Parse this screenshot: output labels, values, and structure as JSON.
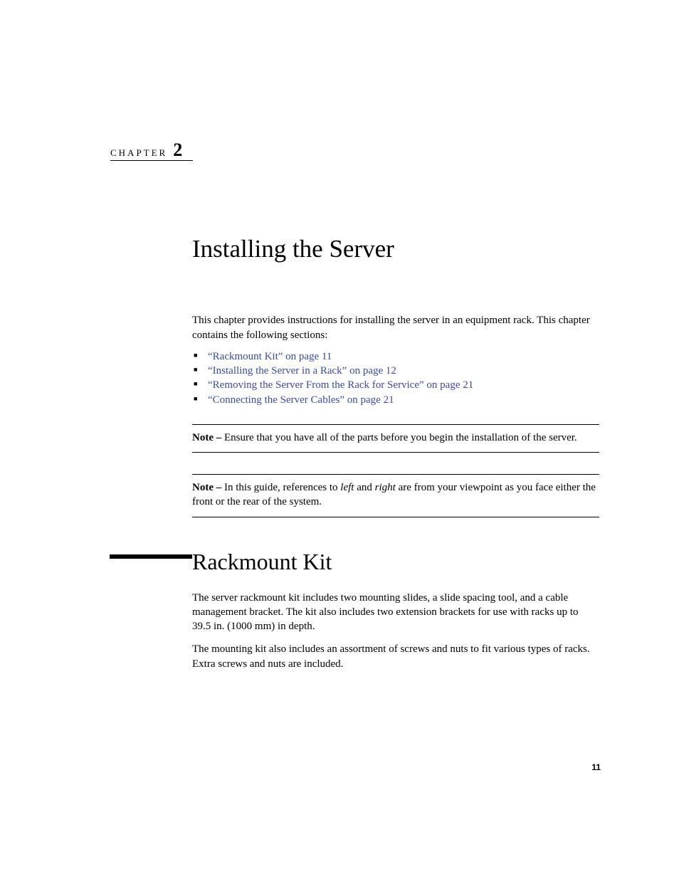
{
  "chapter": {
    "label": "CHAPTER",
    "number": "2"
  },
  "title": "Installing the Server",
  "intro": "This chapter provides instructions for installing the server in an equipment rack. This chapter contains the following sections:",
  "xrefs": [
    "“Rackmount Kit” on page 11",
    "“Installing the Server in a Rack” on page 12",
    "“Removing the Server From the Rack for Service” on page 21",
    "“Connecting the Server Cables” on page 21"
  ],
  "note1": {
    "label": "Note – ",
    "text": "Ensure that you have all of the parts before you begin the installation of the server."
  },
  "note2": {
    "label": "Note – ",
    "pre": "In this guide, references to ",
    "em1": "left",
    "mid": " and ",
    "em2": "right",
    "post": " are from your viewpoint as you face either the front or the rear of the system."
  },
  "section": {
    "title": "Rackmount Kit",
    "p1": "The server rackmount kit includes two mounting slides, a slide spacing tool, and a cable management bracket. The kit also includes two extension brackets for use with racks up to 39.5 in. (1000 mm) in depth.",
    "p2": "The mounting kit also includes an assortment of screws and nuts to fit various types of racks. Extra screws and nuts are included."
  },
  "page_number": "11"
}
